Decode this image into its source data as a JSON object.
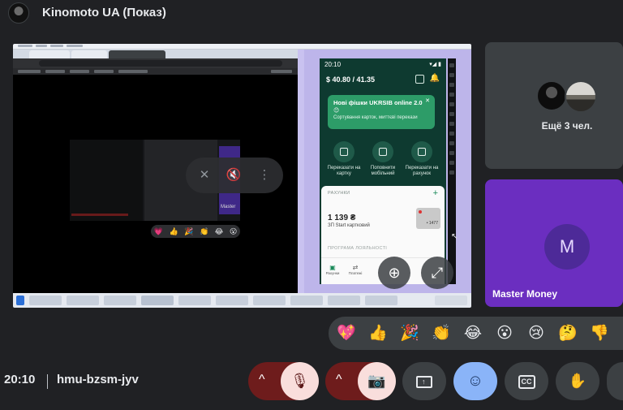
{
  "header": {
    "meeting_title": "Kinomoto UA (Показ)"
  },
  "presentation": {
    "phone": {
      "status_time": "20:10",
      "status_right": "▾◢ ▮",
      "balance": "$ 40.80 / 41.35",
      "banner_title": "Нові фішки UKRSIB online 2.0",
      "banner_emoji": "😊",
      "banner_subtitle": "Сортування карток, миттєві перекази",
      "banner_close": "✕",
      "actions": [
        {
          "label": "Переказати на картку"
        },
        {
          "label": "Поповнити мобільний"
        },
        {
          "label": "Переказати на рахунок"
        }
      ],
      "accounts_header": "РАХУНКИ",
      "add": "+",
      "amount": "1 139 ₴",
      "account_name": "ЗП Start картковий",
      "card_digits": "• 1477",
      "loyalty_header": "ПРОГРАМА ЛОЯЛЬНОСТІ",
      "nav": [
        {
          "label": "Рахунки",
          "icon": "▣"
        },
        {
          "label": "Платежі",
          "icon": "⇄"
        }
      ]
    },
    "mini_tile_label": "Master",
    "mini_reactions": [
      "💗",
      "👍",
      "🎉",
      "👏",
      "😂",
      "😮"
    ],
    "zoom_glyph": "⊕",
    "expand_glyph": "⤢"
  },
  "participants": {
    "others_label": "Ещё 3 чел.",
    "master_initial": "M",
    "master_name": "Master Money"
  },
  "reactions": [
    {
      "name": "sparkling-heart",
      "glyph": "💖"
    },
    {
      "name": "thumbs-up",
      "glyph": "👍"
    },
    {
      "name": "party-popper",
      "glyph": "🎉"
    },
    {
      "name": "clapping",
      "glyph": "👏"
    },
    {
      "name": "tears-of-joy",
      "glyph": "😂"
    },
    {
      "name": "surprised",
      "glyph": "😮"
    },
    {
      "name": "sad",
      "glyph": "😢"
    },
    {
      "name": "thinking",
      "glyph": "🤔"
    },
    {
      "name": "thumbs-down",
      "glyph": "👎"
    }
  ],
  "controls": {
    "time": "20:10",
    "meeting_code": "hmu-bzsm-jyv",
    "chevron": "^",
    "mic_off_icon": "🎙",
    "cam_off_icon": "📷",
    "present_glyph": "↑",
    "emoji_glyph": "☺",
    "captions_glyph": "CC",
    "raise_hand_glyph": "✋"
  },
  "colors": {
    "background": "#202124",
    "tile": "#3c4043",
    "master_tile": "#6b2ec0",
    "mic_cam_off": "#f9dedc",
    "mic_cam_menu": "#6e1c1c",
    "emoji_active": "#8ab4f8"
  }
}
